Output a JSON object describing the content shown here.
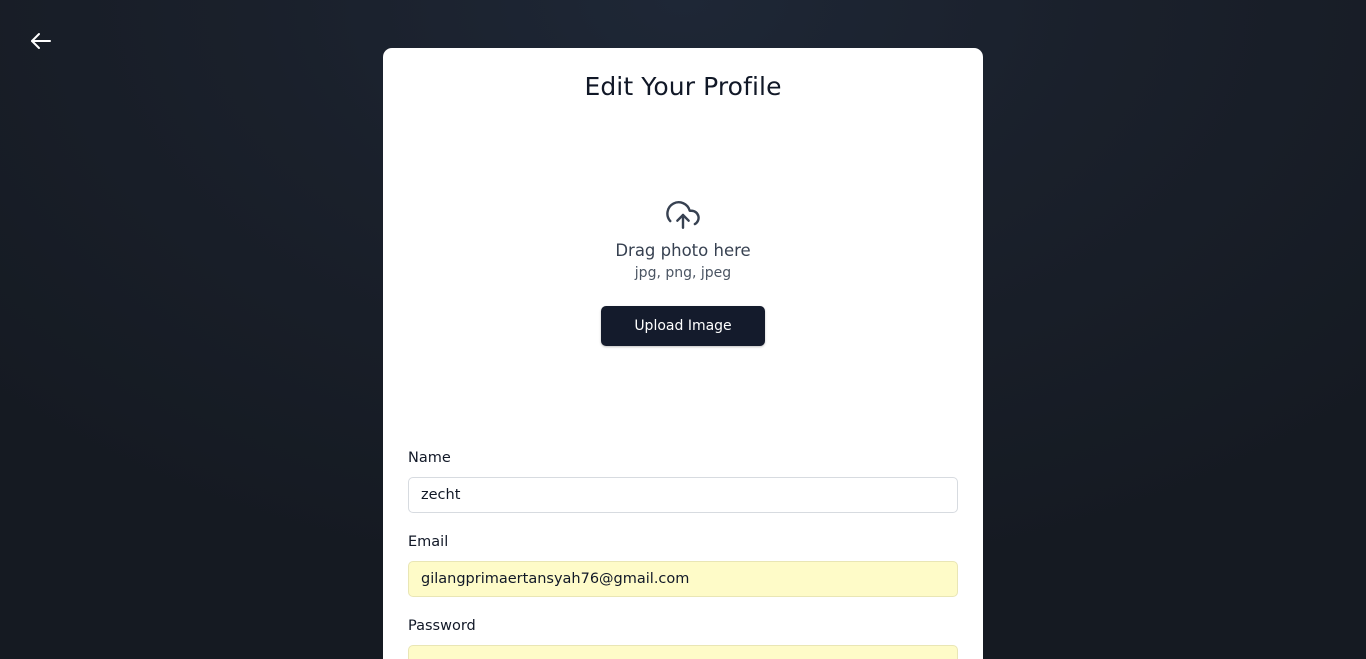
{
  "nav": {
    "back_icon": "arrow-left-icon"
  },
  "card": {
    "title": "Edit Your Profile"
  },
  "upload": {
    "icon": "cloud-upload-icon",
    "drag_text": "Drag photo here",
    "formats": "jpg, png, jpeg",
    "button_label": "Upload Image"
  },
  "form": {
    "name": {
      "label": "Name",
      "value": "zecht"
    },
    "email": {
      "label": "Email",
      "value": "gilangprimaertansyah76@gmail.com"
    },
    "password": {
      "label": "Password",
      "value": ""
    }
  },
  "colors": {
    "background": "#1a202b",
    "card": "#ffffff",
    "button": "#141b2c",
    "autofill": "#fefbc8"
  }
}
